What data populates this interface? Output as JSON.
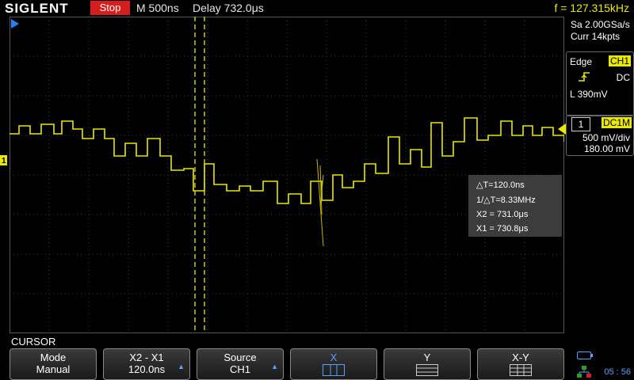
{
  "topbar": {
    "logo": "SIGLENT",
    "run_state": "Stop",
    "timebase": "M 500ns",
    "delay": "Delay 732.0μs",
    "frequency": "f = 127.315kHz"
  },
  "acquisition": {
    "sample_rate": "Sa 2.00GSa/s",
    "memory": "Curr 14kpts"
  },
  "trigger": {
    "type": "Edge",
    "source": "CH1",
    "coupling": "DC",
    "level": "L  390mV",
    "slope_icon": "rising-edge-icon"
  },
  "channel": {
    "number": "1",
    "coupling": "DC1M",
    "scale": "500 mV/div",
    "offset": "180.00 mV",
    "color": "#e8e800"
  },
  "measurements": {
    "delta_t": "△T=120.0ns",
    "inv_delta_t": "1/△T=8.33MHz",
    "x2": "X2 = 731.0μs",
    "x1": "X1 = 730.8μs"
  },
  "menu": {
    "title": "CURSOR",
    "softkeys": [
      {
        "l1": "Mode",
        "l2": "Manual"
      },
      {
        "l1": "X2 - X1",
        "l2": "120.0ns"
      },
      {
        "l1": "Source",
        "l2": "CH1"
      },
      {
        "l1": "X",
        "l2": ""
      },
      {
        "l1": "Y",
        "l2": ""
      },
      {
        "l1": "X-Y",
        "l2": ""
      }
    ]
  },
  "status": {
    "clock": "05 : 56",
    "accent": "#5aa0ff"
  }
}
